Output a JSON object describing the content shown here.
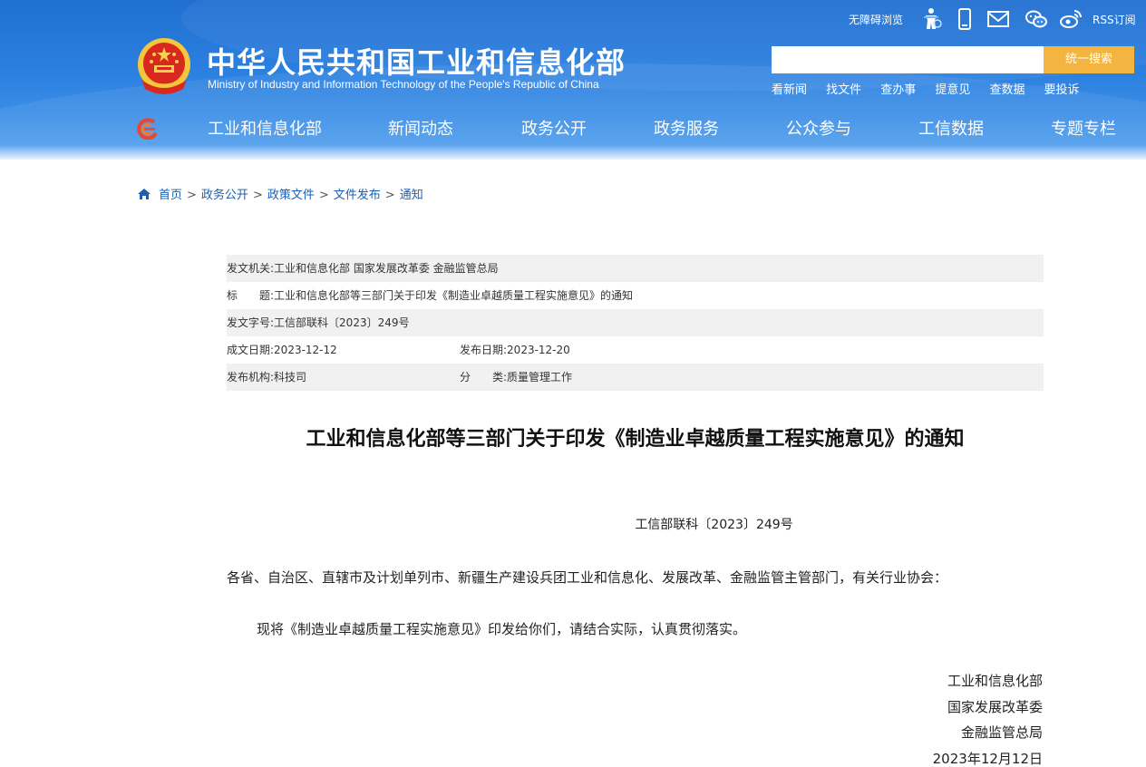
{
  "header": {
    "site_title": "中华人民共和国工业和信息化部",
    "site_subtitle": "Ministry of Industry and Information Technology of the People's Republic of China",
    "accessible_label": "无障碍浏览",
    "rss_label": "RSS订阅",
    "search_placeholder": "",
    "search_button": "统一搜索",
    "quick_links": [
      "看新闻",
      "找文件",
      "查办事",
      "提意见",
      "查数据",
      "要投诉"
    ]
  },
  "nav": {
    "items": [
      "工业和信息化部",
      "新闻动态",
      "政务公开",
      "政务服务",
      "公众参与",
      "工信数据",
      "专题专栏"
    ]
  },
  "breadcrumb": [
    "首页",
    "政务公开",
    "政策文件",
    "文件发布",
    "通知"
  ],
  "meta": {
    "issuer_label": "发文机关:",
    "issuer": "工业和信息化部 国家发展改革委 金融监管总局",
    "title_label": "标　　题:",
    "title": "工业和信息化部等三部门关于印发《制造业卓越质量工程实施意见》的通知",
    "doc_no_label": "发文字号:",
    "doc_no": "工信部联科〔2023〕249号",
    "created_label": "成文日期:",
    "created": "2023-12-12",
    "published_label": "发布日期:",
    "published": "2023-12-20",
    "org_label": "发布机构:",
    "org": "科技司",
    "category_label": "分　　类:",
    "category": "质量管理工作"
  },
  "article": {
    "title": "工业和信息化部等三部门关于印发《制造业卓越质量工程实施意见》的通知",
    "doc_number": "工信部联科〔2023〕249号",
    "addressee": "各省、自治区、直辖市及计划单列市、新疆生产建设兵团工业和信息化、发展改革、金融监管主管部门，有关行业协会：",
    "body": "现将《制造业卓越质量工程实施意见》印发给你们，请结合实际，认真贯彻落实。",
    "signatures": [
      "工业和信息化部",
      "国家发展改革委",
      "金融监管总局"
    ],
    "date": "2023年12月12日"
  },
  "colors": {
    "header_blue": "#2b80e0",
    "search_button": "#f3b540",
    "link_blue": "#1a5fb4",
    "meta_shade": "#f1f1f1"
  },
  "icons": [
    "national-emblem-icon",
    "accessibility-figure-icon",
    "mobile-phone-icon",
    "mail-icon",
    "wechat-icon",
    "weibo-icon",
    "nav-logo-icon",
    "home-icon"
  ]
}
